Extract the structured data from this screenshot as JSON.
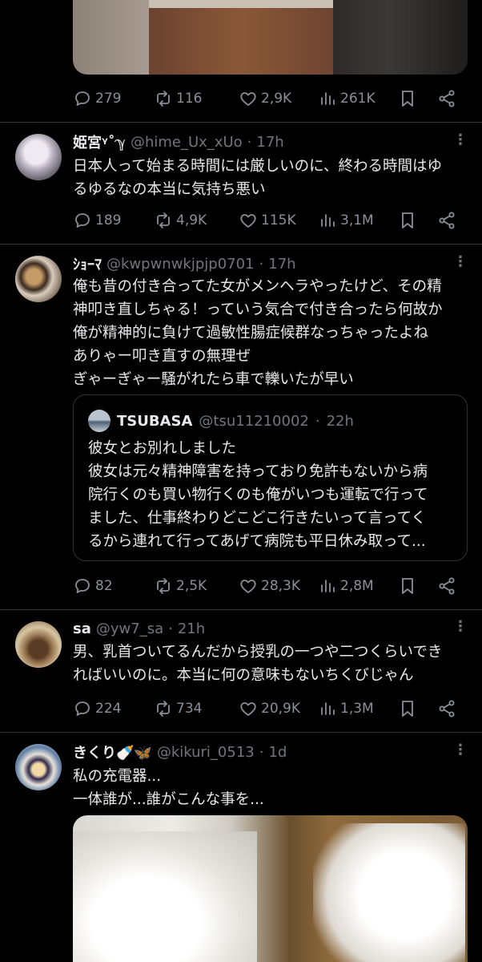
{
  "posts": [
    {
      "stats": {
        "replies": "279",
        "retweets": "116",
        "likes": "2,9K",
        "views": "261K"
      }
    },
    {
      "name": "姫宮ᵞ˚ℽ",
      "handle": "@hime_Ux_xUo",
      "time": "17h",
      "lines": [
        "日本人って始まる時間には厳しいのに、終わる時間はゆ",
        "るゆるなの本当に気持ち悪い"
      ],
      "stats": {
        "replies": "189",
        "retweets": "4,9K",
        "likes": "115K",
        "views": "3,1M"
      }
    },
    {
      "name": "ｼｮｰﾏ",
      "handle": "@kwpwnwkjpjp0701",
      "time": "17h",
      "lines": [
        "俺も昔の付き合ってた女がメンヘラやったけど、その精",
        "神叩き直しちゃる！っていう気合で付き合ったら何故か",
        "俺が精神的に負けて過敏性腸症候群なっちゃったよね",
        "ありゃー叩き直すの無理ぜ",
        "ぎゃーぎゃー騒がれたら車で轢いたが早い"
      ],
      "quote": {
        "name": "TSUBASA",
        "handle": "@tsu11210002",
        "time": "22h",
        "lines": [
          "彼女とお別れしました",
          "彼女は元々精神障害を持っており免許もないから病",
          "院行くのも買い物行くのも俺がいつも運転で行って",
          "ました、仕事終わりどこどこ行きたいって言ってく",
          "るから連れて行ってあげて病院も平日休み取って..."
        ]
      },
      "stats": {
        "replies": "82",
        "retweets": "2,5K",
        "likes": "28,3K",
        "views": "2,8M"
      }
    },
    {
      "name": "sa",
      "handle": "@yw7_sa",
      "time": "21h",
      "lines": [
        "男、乳首ついてるんだから授乳の一つや二つくらいでき",
        "ればいいのに。本当に何の意味もないちくびじゃん"
      ],
      "stats": {
        "replies": "224",
        "retweets": "734",
        "likes": "20,9K",
        "views": "1,3M"
      }
    },
    {
      "name": "きくり🍼🦋",
      "handle": "@kikuri_0513",
      "time": "1d",
      "lines": [
        "私の充電器...",
        "一体誰が...誰がこんな事を..."
      ]
    }
  ],
  "separator": "·",
  "more_glyph": "⋮"
}
